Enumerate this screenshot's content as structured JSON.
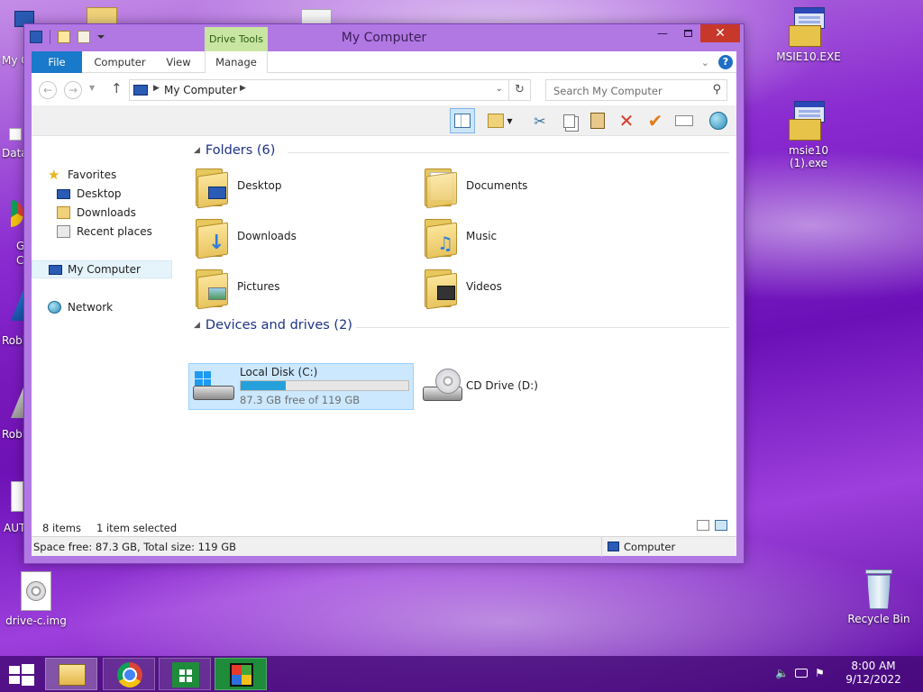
{
  "desktop": {
    "icons": {
      "msie10": "MSIE10.EXE",
      "msie10_1": "msie10 (1).exe",
      "drive_img": "drive-c.img",
      "recycle_bin": "Recycle Bin"
    },
    "partial_labels": {
      "my_computer": "My C",
      "data": "Data",
      "g": "G",
      "c": "C",
      "robl1": "Robl",
      "robl2": "Robl",
      "aut": "AUT"
    }
  },
  "window": {
    "title": "My Computer",
    "contextual_tab_group": "Drive Tools",
    "ribbon_tabs": {
      "file": "File",
      "computer": "Computer",
      "view": "View",
      "manage": "Manage"
    },
    "address": {
      "location": "My Computer"
    },
    "search": {
      "placeholder": "Search My Computer"
    },
    "nav_pane": {
      "favorites": "Favorites",
      "desktop": "Desktop",
      "downloads": "Downloads",
      "recent_places": "Recent places",
      "my_computer": "My Computer",
      "network": "Network"
    },
    "folders_group": {
      "header": "Folders (6)",
      "items": {
        "desktop": "Desktop",
        "documents": "Documents",
        "downloads": "Downloads",
        "music": "Music",
        "pictures": "Pictures",
        "videos": "Videos"
      }
    },
    "drives_group": {
      "header": "Devices and drives (2)",
      "local_disk": {
        "name": "Local Disk (C:)",
        "free_text": "87.3 GB free of 119 GB",
        "used_fraction": 0.27
      },
      "cd_drive": {
        "name": "CD Drive (D:)"
      }
    },
    "status": {
      "items": "8 items",
      "selected": "1 item selected"
    },
    "details": {
      "space": "Space free: 87.3 GB, Total size: 119 GB",
      "location": "Computer"
    }
  },
  "taskbar": {
    "time": "8:00 AM",
    "date": "9/12/2022"
  },
  "colors": {
    "accent": "#1979ca",
    "drive_tools": "#c8e6a2",
    "close": "#c7382a",
    "selection": "#cce8ff",
    "progress": "#26a0da"
  }
}
